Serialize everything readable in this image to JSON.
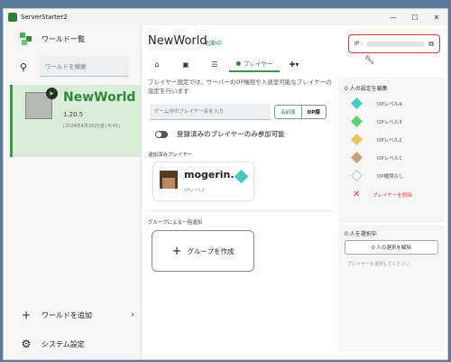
{
  "window": {
    "title": "ServerStarter2"
  },
  "sidebar": {
    "world_list_label": "ワールド一覧",
    "search_placeholder": "ワールドを検索",
    "world": {
      "name": "NewWorld",
      "version": "1.20.5",
      "date": "(2024年4月26日(金) 8:45)"
    },
    "add_world_label": "ワールドを追加",
    "settings_label": "システム設定"
  },
  "main": {
    "title": "NewWorld",
    "status": "起動中",
    "ip_label": "IP :",
    "tabs": [
      {
        "name": "home",
        "icon": "home-icon"
      },
      {
        "name": "console",
        "icon": "console-icon"
      },
      {
        "name": "list",
        "icon": "list-icon"
      },
      {
        "name": "player",
        "icon": "person-icon",
        "label": "プレイヤー"
      },
      {
        "name": "addons",
        "icon": "puzzle-icon"
      },
      {
        "name": "tools",
        "icon": "wrench-icon"
      }
    ],
    "description": "プレイヤー設定では、サーバーのOP権限や入退室可能なプレイヤーの設定を行います",
    "player_search_placeholder": "ゲーム中のプレイヤー名を入力",
    "seg_name": "名前順",
    "seg_op": "OP順",
    "whitelist_label": "登録済みのプレイヤーのみ参加可能",
    "added_players_label": "追加済みプレイヤー",
    "players": [
      {
        "name": "mogerin...",
        "level": "OPレベル4"
      }
    ],
    "group_section_label": "グループによる一括追加",
    "create_group_label": "グループを作成"
  },
  "right_panel": {
    "edit_title": "0 人の設定を編集",
    "levels": [
      {
        "label": "OPレベル4",
        "color": "#46c9c0"
      },
      {
        "label": "OPレベル3",
        "color": "#5ccf7a"
      },
      {
        "label": "OPレベル2",
        "color": "#e9c25a"
      },
      {
        "label": "OPレベル1",
        "color": "#c9a07a"
      },
      {
        "label": "OP権限なし",
        "color": "#ffffff"
      }
    ],
    "remove_label": "プレイヤーを削除",
    "selected_title": "0 人を選択中",
    "unselect_label": "0 人の選択を解除",
    "select_hint": "プレイヤーを選択してください"
  },
  "colors": {
    "accent": "#3c9a47",
    "danger": "#e03434"
  }
}
